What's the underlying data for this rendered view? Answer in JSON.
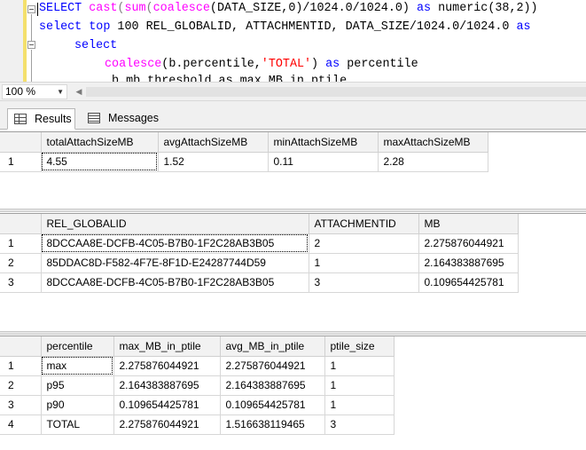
{
  "editor": {
    "line1": {
      "kw1": "SELECT",
      "fn1": "cast",
      "p1": "(",
      "fn2": "sum",
      "p2": "(",
      "fn3": "coalesce",
      "p3": "(DATA_SIZE,0)/1024.0/1024.0)",
      "kw2": "as",
      "t1": "numeric(38,2))"
    },
    "line2": {
      "kw1": "select",
      "kw2": "top",
      "t1": "100 REL_GLOBALID, ATTACHMENTID, DATA_SIZE/1024.0/1024.0",
      "kw3": "as"
    },
    "line3": {
      "kw1": "select"
    },
    "line4": {
      "fn1": "coalesce",
      "t1": "(b.percentile,",
      "str1": "'TOTAL'",
      "t2": ")",
      "kw1": "as",
      "t3": "percentile"
    },
    "line5": {
      "t1": "b.mb_threshold as max_MB_in_ptile"
    }
  },
  "zoom": {
    "value": "100 %"
  },
  "tabs": [
    {
      "label": "Results",
      "active": true
    },
    {
      "label": "Messages",
      "active": false
    }
  ],
  "grid1": {
    "columns": [
      "totalAttachSizeMB",
      "avgAttachSizeMB",
      "minAttachSizeMB",
      "maxAttachSizeMB"
    ],
    "rows": [
      {
        "rn": "1",
        "cells": [
          "4.55",
          "1.52",
          "0.11",
          "2.28"
        ]
      }
    ]
  },
  "grid2": {
    "columns": [
      "REL_GLOBALID",
      "ATTACHMENTID",
      "MB"
    ],
    "rows": [
      {
        "rn": "1",
        "cells": [
          "8DCCAA8E-DCFB-4C05-B7B0-1F2C28AB3B05",
          "2",
          "2.275876044921"
        ]
      },
      {
        "rn": "2",
        "cells": [
          "85DDAC8D-F582-4F7E-8F1D-E24287744D59",
          "1",
          "2.164383887695"
        ]
      },
      {
        "rn": "3",
        "cells": [
          "8DCCAA8E-DCFB-4C05-B7B0-1F2C28AB3B05",
          "3",
          "0.109654425781"
        ]
      }
    ]
  },
  "grid3": {
    "columns": [
      "percentile",
      "max_MB_in_ptile",
      "avg_MB_in_ptile",
      "ptile_size"
    ],
    "rows": [
      {
        "rn": "1",
        "cells": [
          "max",
          "2.275876044921",
          "2.275876044921",
          "1"
        ]
      },
      {
        "rn": "2",
        "cells": [
          "p95",
          "2.164383887695",
          "2.164383887695",
          "1"
        ]
      },
      {
        "rn": "3",
        "cells": [
          "p90",
          "0.109654425781",
          "0.109654425781",
          "1"
        ]
      },
      {
        "rn": "4",
        "cells": [
          "TOTAL",
          "2.275876044921",
          "1.516638119465",
          "3"
        ]
      }
    ]
  }
}
